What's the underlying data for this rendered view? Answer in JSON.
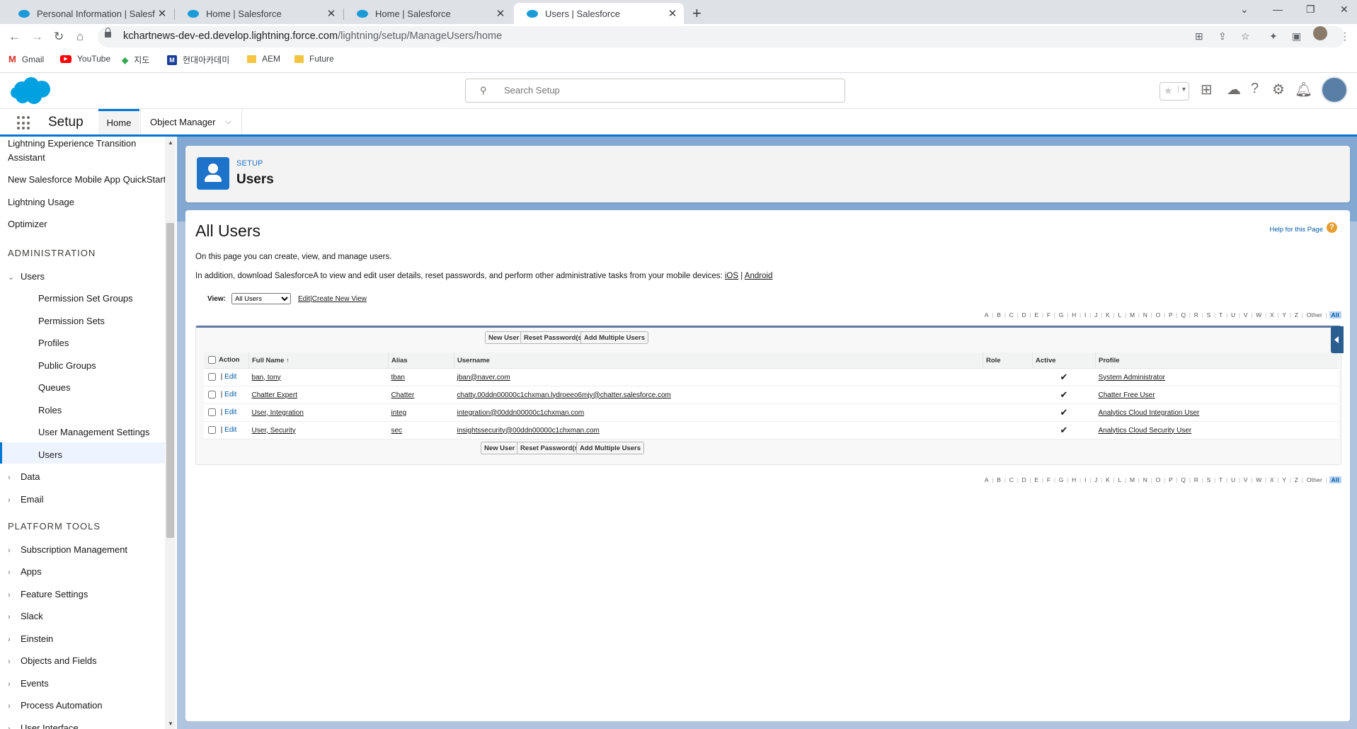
{
  "browser": {
    "tabs": [
      {
        "title": "Personal Information | Salesforce"
      },
      {
        "title": "Home | Salesforce"
      },
      {
        "title": "Home | Salesforce"
      },
      {
        "title": "Users | Salesforce"
      }
    ],
    "url_host": "kchartnews-dev-ed.develop.lightning.force.com",
    "url_path": "/lightning/setup/ManageUsers/home",
    "bookmarks": [
      {
        "label": "Gmail",
        "icon": "gmail-icon"
      },
      {
        "label": "YouTube",
        "icon": "youtube-icon"
      },
      {
        "label": "지도",
        "icon": "maps-icon"
      },
      {
        "label": "현대아카데미",
        "icon": "m-icon"
      },
      {
        "label": "AEM",
        "icon": "folder-icon"
      },
      {
        "label": "Future",
        "icon": "folder-icon"
      }
    ]
  },
  "header": {
    "search_placeholder": "Search Setup"
  },
  "appnav": {
    "app_name": "Setup",
    "tabs": [
      {
        "label": "Home"
      },
      {
        "label": "Object Manager"
      }
    ]
  },
  "sidebar": {
    "items_top": [
      {
        "label": "Lightning Experience Transition"
      },
      {
        "label": "Assistant"
      },
      {
        "label": "New Salesforce Mobile App QuickStart"
      },
      {
        "label": "Lightning Usage"
      },
      {
        "label": "Optimizer"
      }
    ],
    "admin_heading": "ADMINISTRATION",
    "users_group": "Users",
    "users_children": [
      {
        "label": "Permission Set Groups"
      },
      {
        "label": "Permission Sets"
      },
      {
        "label": "Profiles"
      },
      {
        "label": "Public Groups"
      },
      {
        "label": "Queues"
      },
      {
        "label": "Roles"
      },
      {
        "label": "User Management Settings"
      },
      {
        "label": "Users"
      }
    ],
    "admin_more": [
      {
        "label": "Data"
      },
      {
        "label": "Email"
      }
    ],
    "platform_heading": "PLATFORM TOOLS",
    "platform_items": [
      {
        "label": "Subscription Management"
      },
      {
        "label": "Apps"
      },
      {
        "label": "Feature Settings"
      },
      {
        "label": "Slack"
      },
      {
        "label": "Einstein"
      },
      {
        "label": "Objects and Fields"
      },
      {
        "label": "Events"
      },
      {
        "label": "Process Automation"
      },
      {
        "label": "User Interface"
      }
    ]
  },
  "page_header": {
    "eyebrow": "SETUP",
    "title": "Users"
  },
  "content": {
    "title": "All Users",
    "help": "Help for this Page",
    "desc1": "On this page you can create, view, and manage users.",
    "desc2_prefix": "In addition, download SalesforceA to view and edit user details, reset passwords, and perform other administrative tasks from your mobile devices: ",
    "ios": "iOS",
    "sep": " | ",
    "android": "Android",
    "view_label": "View:",
    "view_value": "All Users",
    "view_edit": "Edit",
    "view_create": "Create New View",
    "alphabet": [
      "A",
      "B",
      "C",
      "D",
      "E",
      "F",
      "G",
      "H",
      "I",
      "J",
      "K",
      "L",
      "M",
      "N",
      "O",
      "P",
      "Q",
      "R",
      "S",
      "T",
      "U",
      "V",
      "W",
      "X",
      "Y",
      "Z",
      "Other",
      "All"
    ],
    "buttons": {
      "new_user": "New User",
      "reset": "Reset Password(s)",
      "add_multiple": "Add Multiple Users"
    },
    "columns": [
      "Action",
      "Full Name",
      "Alias",
      "Username",
      "Role",
      "Active",
      "Profile"
    ],
    "sort_glyph": "↑",
    "edit_label": "Edit",
    "active_glyph": "✔",
    "rows": [
      {
        "full_name": "ban, tony",
        "alias": "tban",
        "username": "jban@naver.com",
        "role": "",
        "profile": "System Administrator"
      },
      {
        "full_name": "Chatter Expert",
        "alias": "Chatter",
        "username": "chatty.00ddn00000c1chxman.lydroeeo6mjy@chatter.salesforce.com",
        "role": "",
        "profile": "Chatter Free User"
      },
      {
        "full_name": "User, Integration",
        "alias": "integ",
        "username": "integration@00ddn00000c1chxman.com",
        "role": "",
        "profile": "Analytics Cloud Integration User"
      },
      {
        "full_name": "User, Security",
        "alias": "sec",
        "username": "insightssecurity@00ddn00000c1chxman.com",
        "role": "",
        "profile": "Analytics Cloud Security User"
      }
    ]
  },
  "colors": {
    "brand": "#0176d3",
    "link": "#015ba7",
    "setup_icon": "#1d73c9"
  }
}
